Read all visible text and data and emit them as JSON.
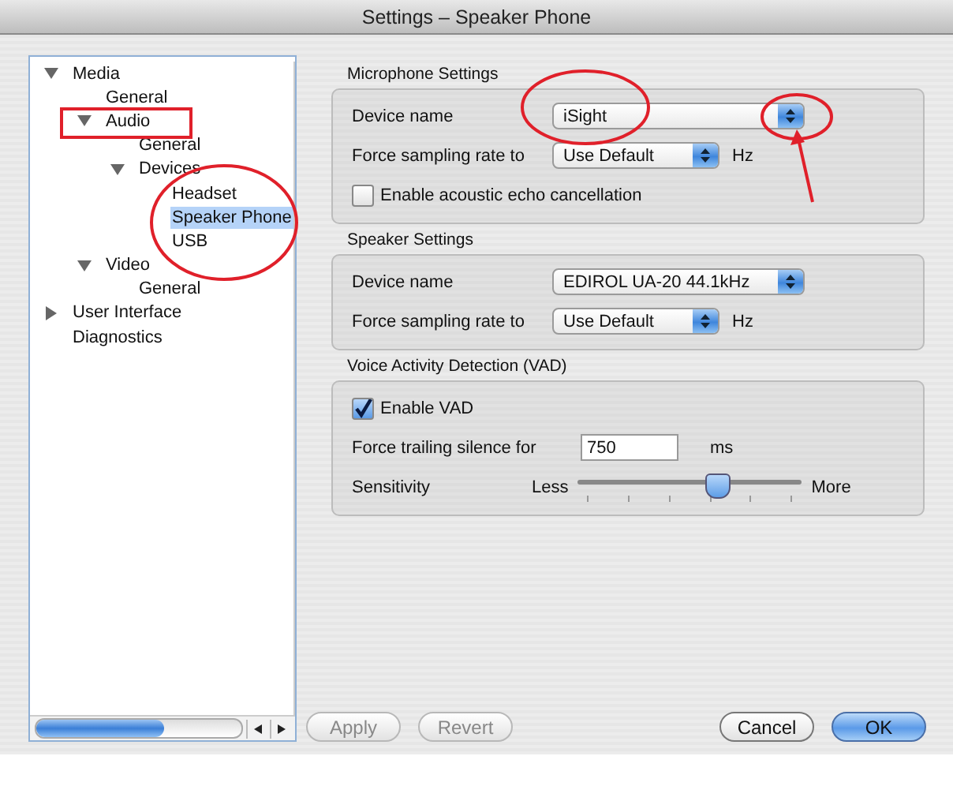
{
  "window": {
    "title": "Settings – Speaker Phone"
  },
  "tree": [
    {
      "label": "Media",
      "expanded": true,
      "selected": false,
      "children": [
        {
          "label": "General",
          "selected": false
        },
        {
          "label": "Audio",
          "expanded": true,
          "selected": false,
          "children": [
            {
              "label": "General",
              "selected": false
            },
            {
              "label": "Devices",
              "expanded": true,
              "selected": false,
              "children": [
                {
                  "label": "Headset",
                  "selected": false
                },
                {
                  "label": "Speaker Phone",
                  "selected": true
                },
                {
                  "label": "USB",
                  "selected": false
                }
              ]
            }
          ]
        },
        {
          "label": "Video",
          "expanded": true,
          "selected": false,
          "children": [
            {
              "label": "General",
              "selected": false
            }
          ]
        }
      ]
    },
    {
      "label": "User Interface",
      "expanded": false,
      "selected": false
    },
    {
      "label": "Diagnostics",
      "selected": false
    }
  ],
  "sections": [
    {
      "title": "Microphone Settings",
      "rows": [
        {
          "kind": "popup",
          "label": "Device name",
          "value": "iSight"
        },
        {
          "kind": "popup",
          "label": "Force sampling rate to",
          "value": "Use Default",
          "unit": "Hz"
        },
        {
          "kind": "checkbox",
          "label": "Enable acoustic echo cancellation",
          "checked": false
        }
      ]
    },
    {
      "title": "Speaker Settings",
      "rows": [
        {
          "kind": "popup",
          "label": "Device name",
          "value": "EDIROL UA-20 44.1kHz"
        },
        {
          "kind": "popup",
          "label": "Force sampling rate to",
          "value": "Use Default",
          "unit": "Hz"
        }
      ]
    },
    {
      "title": "Voice Activity Detection (VAD)",
      "rows": [
        {
          "kind": "checkbox",
          "label": "Enable VAD",
          "checked": true
        },
        {
          "kind": "text",
          "label": "Force trailing silence for",
          "value": "750",
          "unit": "ms"
        },
        {
          "kind": "slider",
          "label": "Sensitivity",
          "min_label": "Less",
          "max_label": "More",
          "level": 0.62
        }
      ]
    }
  ],
  "buttons": [
    {
      "label": "Apply",
      "disabled": true,
      "default": false
    },
    {
      "label": "Revert",
      "disabled": true,
      "default": false
    },
    {
      "label": "Cancel",
      "disabled": false,
      "default": false
    },
    {
      "label": "OK",
      "disabled": false,
      "default": true
    }
  ]
}
